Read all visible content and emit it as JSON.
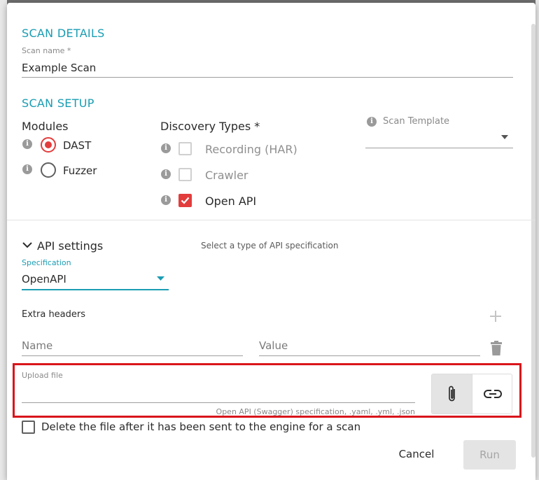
{
  "scan_details": {
    "title": "SCAN DETAILS",
    "name_label": "Scan name *",
    "name_value": "Example Scan"
  },
  "scan_setup": {
    "title": "SCAN SETUP",
    "modules": {
      "heading": "Modules",
      "options": [
        {
          "label": "DAST",
          "selected": true
        },
        {
          "label": "Fuzzer",
          "selected": false
        }
      ]
    },
    "discovery": {
      "heading": "Discovery Types *",
      "options": [
        {
          "label": "Recording (HAR)",
          "checked": false,
          "enabled": false
        },
        {
          "label": "Crawler",
          "checked": false,
          "enabled": false
        },
        {
          "label": "Open API",
          "checked": true,
          "enabled": true
        }
      ]
    },
    "template": {
      "label": "Scan Template",
      "value": ""
    }
  },
  "api_settings": {
    "heading": "API settings",
    "hint": "Select a type of API specification",
    "spec_label": "Specification",
    "spec_value": "OpenAPI",
    "extra_headers_label": "Extra headers",
    "name_placeholder": "Name",
    "value_placeholder": "Value",
    "upload_label": "Upload file",
    "upload_helper": "Open API (Swagger) specification, .yaml, .yml, .json"
  },
  "delete_file_label": "Delete the file after it has been sent to the engine for a scan",
  "actions": {
    "cancel": "Cancel",
    "run": "Run"
  },
  "colors": {
    "accent_teal": "#1a9db3",
    "accent_red": "#e33c3c",
    "highlight_red": "#d9151b"
  },
  "icons": [
    "info-icon",
    "plus-icon",
    "trash-icon",
    "paperclip-icon",
    "link-icon",
    "chevron-down-icon",
    "dropdown-arrow-icon"
  ]
}
